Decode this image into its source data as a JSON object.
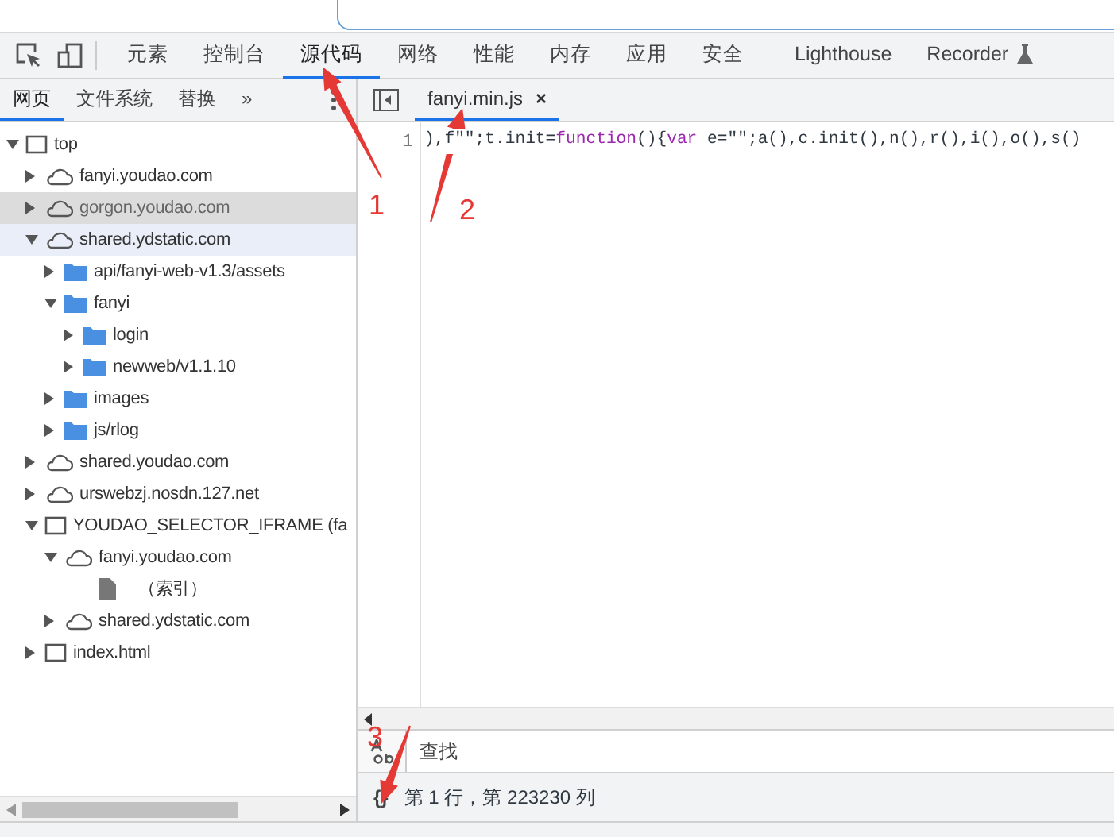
{
  "main_tabs": [
    {
      "label": "元素",
      "selected": false
    },
    {
      "label": "控制台",
      "selected": false
    },
    {
      "label": "源代码",
      "selected": true
    },
    {
      "label": "网络",
      "selected": false
    },
    {
      "label": "性能",
      "selected": false
    },
    {
      "label": "内存",
      "selected": false
    },
    {
      "label": "应用",
      "selected": false
    },
    {
      "label": "安全",
      "selected": false
    },
    {
      "label": "Lighthouse",
      "selected": false
    },
    {
      "label": "Recorder",
      "selected": false,
      "experimental": true
    }
  ],
  "navigator": {
    "tabs": [
      {
        "label": "网页",
        "selected": true
      },
      {
        "label": "文件系统",
        "selected": false
      },
      {
        "label": "替换",
        "selected": false
      }
    ],
    "more_tabs": "»",
    "tree": [
      {
        "kind": "frame",
        "label": "top",
        "expanded": true,
        "selected": false,
        "hovered": false,
        "children": [
          {
            "kind": "domain",
            "label": "fanyi.youdao.com",
            "expanded": false,
            "selected": false,
            "hovered": false
          },
          {
            "kind": "domain",
            "label": "gorgon.youdao.com",
            "expanded": false,
            "selected": false,
            "hovered": true
          },
          {
            "kind": "domain",
            "label": "shared.ydstatic.com",
            "expanded": true,
            "selected": true,
            "hovered": false,
            "children": [
              {
                "kind": "folder",
                "label": "api/fanyi-web-v1.3/assets",
                "expanded": false,
                "selected": false,
                "hovered": false
              },
              {
                "kind": "folder",
                "label": "fanyi",
                "expanded": true,
                "selected": false,
                "hovered": false,
                "children": [
                  {
                    "kind": "folder",
                    "label": "login",
                    "expanded": false,
                    "selected": false,
                    "hovered": false
                  },
                  {
                    "kind": "folder",
                    "label": "newweb/v1.1.10",
                    "expanded": false,
                    "selected": false,
                    "hovered": false
                  }
                ]
              },
              {
                "kind": "folder",
                "label": "images",
                "expanded": false,
                "selected": false,
                "hovered": false
              },
              {
                "kind": "folder",
                "label": "js/rlog",
                "expanded": false,
                "selected": false,
                "hovered": false
              }
            ]
          },
          {
            "kind": "domain",
            "label": "shared.youdao.com",
            "expanded": false,
            "selected": false,
            "hovered": false
          },
          {
            "kind": "domain",
            "label": "urswebzj.nosdn.127.net",
            "expanded": false,
            "selected": false,
            "hovered": false
          },
          {
            "kind": "frame",
            "label": "YOUDAO_SELECTOR_IFRAME (fa",
            "expanded": true,
            "selected": false,
            "hovered": false,
            "children": [
              {
                "kind": "domain",
                "label": "fanyi.youdao.com",
                "expanded": true,
                "selected": false,
                "hovered": false,
                "children": [
                  {
                    "kind": "file",
                    "label": "（索引）",
                    "selected": false,
                    "hovered": false
                  }
                ]
              },
              {
                "kind": "domain",
                "label": "shared.ydstatic.com",
                "expanded": false,
                "selected": false,
                "hovered": false
              }
            ]
          },
          {
            "kind": "frame",
            "label": "index.html",
            "expanded": false,
            "selected": false,
            "hovered": false
          }
        ]
      }
    ]
  },
  "editor": {
    "file_tabs": [
      {
        "label": "fanyi.min.js",
        "close": "×",
        "selected": true
      }
    ],
    "lines": [
      {
        "number": "1",
        "tokens": [
          {
            "kind": "plain",
            "text": "),f\"\";t.init="
          },
          {
            "kind": "keyword",
            "text": "function"
          },
          {
            "kind": "plain",
            "text": "(){"
          },
          {
            "kind": "keyword",
            "text": "var"
          },
          {
            "kind": "plain",
            "text": " e=\"\";a(),c.init(),n(),r(),i(),o(),s()"
          }
        ]
      }
    ],
    "search": {
      "placeholder": "查找"
    },
    "status": {
      "format": "{}",
      "position": "第 1 行，第 223230 列"
    }
  },
  "annotations": [
    {
      "label": "1"
    },
    {
      "label": "2"
    },
    {
      "label": "3"
    }
  ]
}
